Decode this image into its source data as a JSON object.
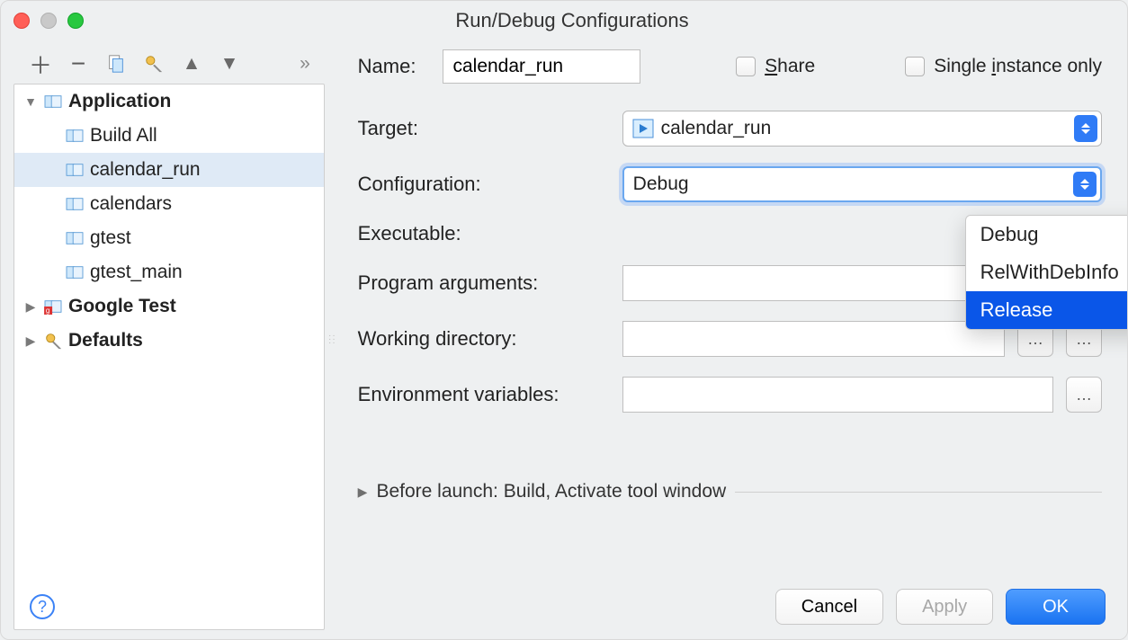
{
  "window": {
    "title": "Run/Debug Configurations"
  },
  "toolbar": {
    "add": "+",
    "remove": "−",
    "copy": "copy",
    "settings": "settings",
    "up": "up",
    "down": "down",
    "more": "»"
  },
  "tree": {
    "categories": [
      {
        "name": "Application",
        "expanded": true,
        "children": [
          {
            "label": "Build All"
          },
          {
            "label": "calendar_run",
            "selected": true
          },
          {
            "label": "calendars"
          },
          {
            "label": "gtest"
          },
          {
            "label": "gtest_main"
          }
        ]
      },
      {
        "name": "Google Test",
        "expanded": false
      },
      {
        "name": "Defaults",
        "expanded": false
      }
    ]
  },
  "form": {
    "name_label": "Name:",
    "name_value": "calendar_run",
    "share_label": "Share",
    "single_instance_label": "Single instance only",
    "target_label": "Target:",
    "target_value": "calendar_run",
    "configuration_label": "Configuration:",
    "configuration_value": "Debug",
    "configuration_options": [
      "Debug",
      "RelWithDebInfo",
      "Release"
    ],
    "configuration_highlighted": "Release",
    "executable_label": "Executable:",
    "program_args_label": "Program arguments:",
    "working_dir_label": "Working directory:",
    "env_vars_label": "Environment variables:",
    "before_launch": "Before launch: Build, Activate tool window"
  },
  "buttons": {
    "cancel": "Cancel",
    "apply": "Apply",
    "ok": "OK"
  }
}
